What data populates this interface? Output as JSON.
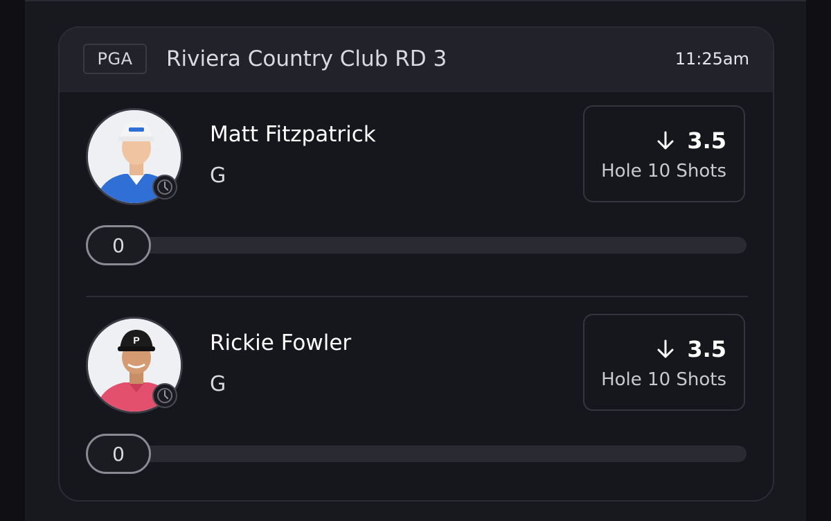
{
  "event": {
    "league": "PGA",
    "title": "Riviera Country Club RD 3",
    "time": "11:25am"
  },
  "players": [
    {
      "name": "Matt Fitzpatrick",
      "position": "G",
      "line": {
        "direction_icon": "arrow-down-icon",
        "value": "3.5",
        "label": "Hole 10 Shots"
      },
      "progress": {
        "current": "0",
        "fraction": 0
      },
      "shirt_color": "#2f6fd6",
      "cap_color": "#f4f4f4"
    },
    {
      "name": "Rickie Fowler",
      "position": "G",
      "line": {
        "direction_icon": "arrow-down-icon",
        "value": "3.5",
        "label": "Hole 10 Shots"
      },
      "progress": {
        "current": "0",
        "fraction": 0
      },
      "shirt_color": "#e2506e",
      "cap_color": "#1b1b1b"
    }
  ]
}
